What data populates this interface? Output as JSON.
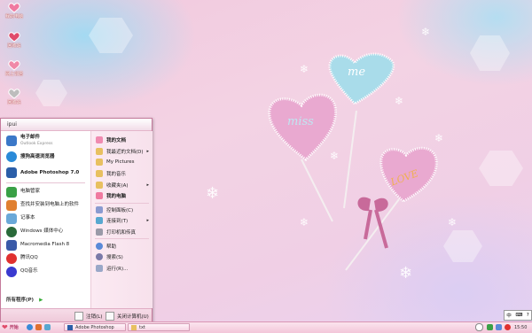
{
  "desktop_icons": [
    {
      "label": "我的电脑",
      "color": "#f07aa0"
    },
    {
      "label": "回收站",
      "color": "#e04c6a"
    },
    {
      "label": "网上邻居",
      "color": "#f08aa8"
    },
    {
      "label": "回收站",
      "color": "#bdbdbd"
    }
  ],
  "lollipops": [
    {
      "text": "me",
      "color": "#a9dcea"
    },
    {
      "text": "miss",
      "color": "#e9a9d0"
    },
    {
      "text": "LOVE",
      "color": "#e9a9d0"
    }
  ],
  "start_menu": {
    "user": "ipui",
    "pinned": [
      {
        "label": "电子邮件",
        "sub": "Outlook Express",
        "color": "#3b78c8"
      },
      {
        "label": "搜狗高速浏览器",
        "sub": "",
        "color": "#2a8ad8"
      },
      {
        "label": "Adobe Photoshop 7.0",
        "sub": "",
        "color": "#2b5ea8"
      }
    ],
    "recent": [
      {
        "label": "电脑管家",
        "color": "#3aa046"
      },
      {
        "label": "查找并安装到电脑上的软件",
        "color": "#e08030"
      },
      {
        "label": "记事本",
        "color": "#6aa8d8"
      },
      {
        "label": "Windows 媒体中心",
        "color": "#2a6a3a"
      },
      {
        "label": "Macromedia Flash 8",
        "color": "#3a5aa8"
      },
      {
        "label": "腾讯QQ",
        "color": "#e03030"
      },
      {
        "label": "QQ音乐",
        "color": "#3a3ad0"
      }
    ],
    "all_programs": "所有程序(P)",
    "right": [
      {
        "label": "我的文档",
        "color": "#f08ab0",
        "sub": ""
      },
      {
        "label": "我最近的文档(D)",
        "color": "#e8c060",
        "sub": "▸"
      },
      {
        "label": "My Pictures",
        "color": "#e8c060",
        "sub": ""
      },
      {
        "label": "我的音乐",
        "color": "#e8c060",
        "sub": ""
      },
      {
        "label": "收藏夹(A)",
        "color": "#e8c060",
        "sub": "▸"
      },
      {
        "label": "我的电脑",
        "color": "#f07aa0",
        "sub": ""
      },
      {
        "label": "控制面板(C)",
        "color": "#8a9ad0",
        "sub": ""
      },
      {
        "label": "连接到(T)",
        "color": "#58a8d0",
        "sub": "▸"
      },
      {
        "label": "打印机和传真",
        "color": "#9a9aa8",
        "sub": ""
      },
      {
        "label": "帮助",
        "color": "#5a8ad8",
        "sub": ""
      },
      {
        "label": "搜索(S)",
        "color": "#7a7aa8",
        "sub": ""
      },
      {
        "label": "运行(R)...",
        "color": "#9aa8c8",
        "sub": ""
      }
    ],
    "logoff": "注销(L)",
    "shutdown": "关闭计算机(U)"
  },
  "taskbar": {
    "start": "开始",
    "buttons": [
      "Adobe Photoshop",
      "txt"
    ],
    "lang": "中",
    "time": "15:50"
  }
}
